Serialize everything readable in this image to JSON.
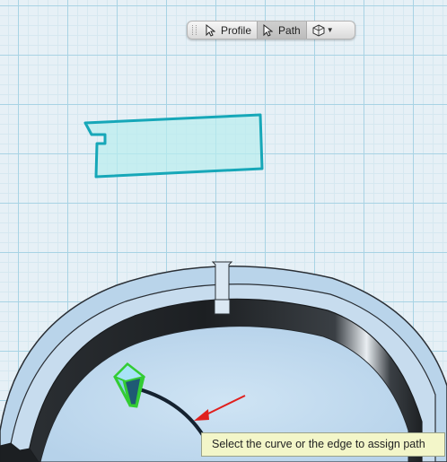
{
  "toolbar": {
    "profile_label": "Profile",
    "path_label": "Path",
    "view_icon": "view-cube-icon",
    "cursor_icon": "arrow-cursor-icon"
  },
  "tooltip": {
    "text": "Select the curve or the edge to assign path"
  },
  "colors": {
    "grid_major": "#a8d3e4",
    "grid_minor": "#d6e8f0",
    "profile_outline": "#16a7b8",
    "profile_fill": "#b8ecee",
    "selection_green": "#33cc33",
    "arrow_red": "#e0201e",
    "tooltip_bg": "#f3f6c9"
  }
}
